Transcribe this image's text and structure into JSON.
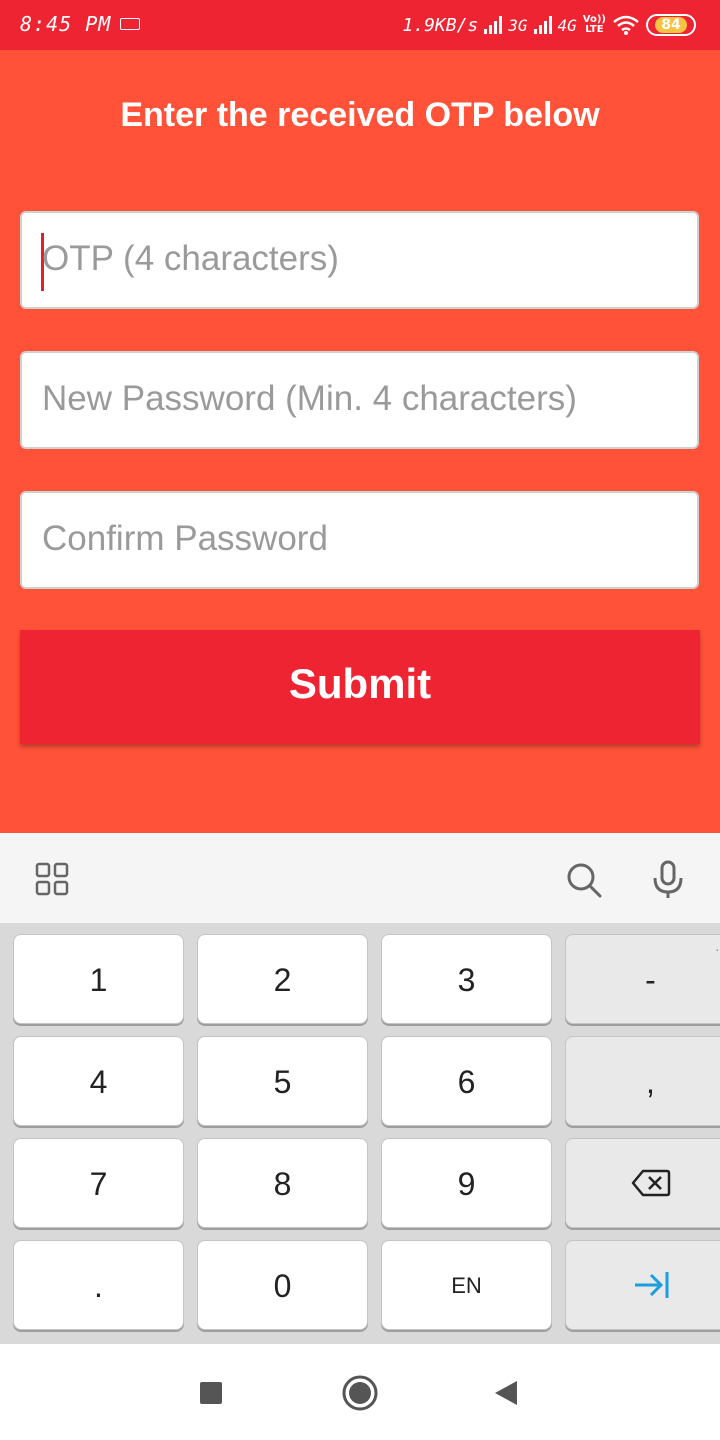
{
  "status_bar": {
    "time": "8:45 PM",
    "speed": "1.9KB/s",
    "network1": "3G",
    "network2": "4G",
    "volte_top": "Vo))",
    "volte_bottom": "LTE",
    "battery": "84",
    "icons": [
      "keyboard-icon",
      "signal-icon",
      "wifi-icon",
      "battery-icon"
    ]
  },
  "form": {
    "title": "Enter the received OTP below",
    "otp_placeholder": "OTP (4 characters)",
    "new_password_placeholder": "New Password (Min. 4 characters)",
    "confirm_password_placeholder": "Confirm Password",
    "submit_label": "Submit"
  },
  "keyboard": {
    "toolbar_icons": [
      "apps-grid-icon",
      "search-icon",
      "microphone-icon"
    ],
    "keys": [
      [
        "1",
        "2",
        "3",
        "-"
      ],
      [
        "4",
        "5",
        "6",
        ","
      ],
      [
        "7",
        "8",
        "9",
        "backspace-icon"
      ],
      [
        ".",
        "0",
        "EN",
        "tab-next-icon"
      ]
    ],
    "more_indicator": "..."
  },
  "nav_bar": {
    "icons": [
      "recents-square-icon",
      "home-circle-icon",
      "back-triangle-icon"
    ]
  },
  "colors": {
    "background": "#ff5238",
    "accent": "#ee2433",
    "caret": "#e02030",
    "next_key": "#1a9ee0"
  }
}
